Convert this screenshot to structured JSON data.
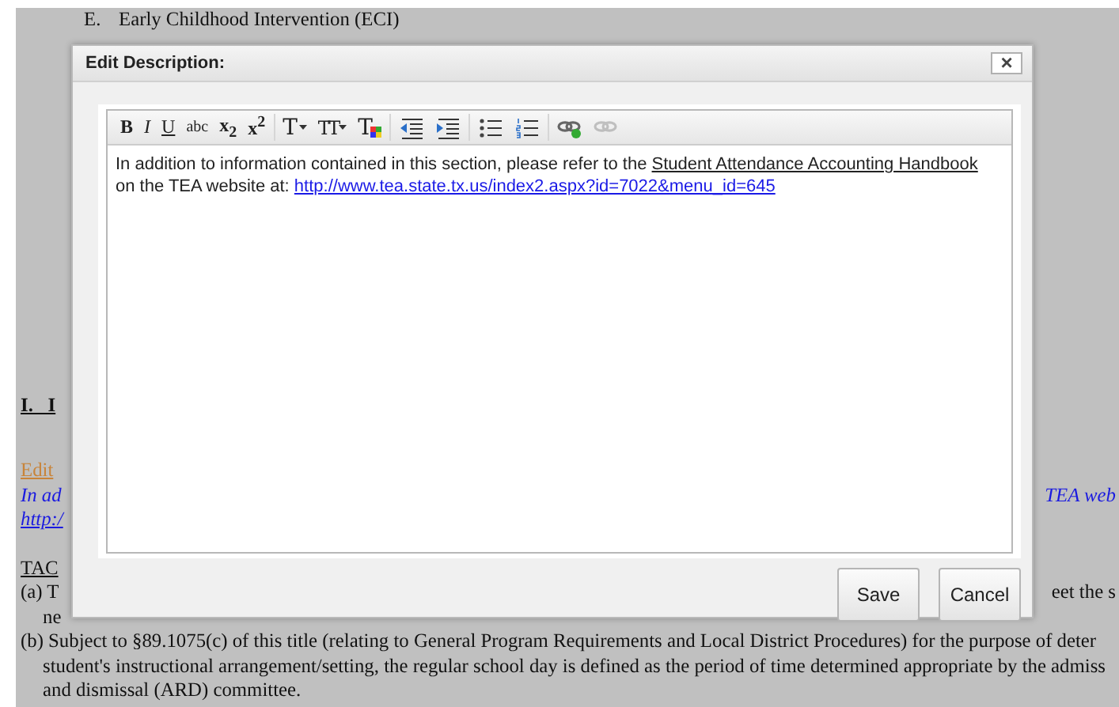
{
  "page": {
    "lines": [
      {
        "kind": "item",
        "left": "E.",
        "text": "Early Childhood Intervention (ECI)"
      },
      {
        "kind": "heading",
        "text": "I.   I"
      },
      {
        "kind": "edit-link",
        "text": "Edit"
      },
      {
        "kind": "note",
        "text": "In ad",
        "right": "TEA web"
      },
      {
        "kind": "note-link",
        "text": "http:/"
      },
      {
        "kind": "section",
        "text": "TAC"
      },
      {
        "kind": "para",
        "text": "(a) T",
        "right": "eet the s"
      },
      {
        "kind": "cont",
        "text": "ne"
      },
      {
        "kind": "para",
        "text": "(b) Subject to §89.1075(c) of this title (relating to General Program Requirements and Local District Procedures) for the purpose of deter"
      },
      {
        "kind": "cont",
        "text": "student's instructional arrangement/setting, the regular school day is defined as the period of time determined appropriate by the admiss"
      },
      {
        "kind": "cont",
        "text": "and dismissal (ARD) committee."
      }
    ]
  },
  "dialog": {
    "title": "Edit Description:",
    "close": "×",
    "toolbar": [
      {
        "kind": "bold",
        "label": "B",
        "disabled": false
      },
      {
        "kind": "italic",
        "label": "I",
        "disabled": false
      },
      {
        "kind": "underline",
        "label": "U",
        "disabled": false
      },
      {
        "kind": "strike",
        "label": "abc",
        "disabled": false
      },
      {
        "kind": "sub",
        "label": "x$_{2}$",
        "disabled": false
      },
      {
        "kind": "sup",
        "label": "x$^{2}$",
        "disabled": false
      },
      {
        "kind": "font",
        "label": "T",
        "disabled": false
      },
      {
        "kind": "size",
        "label": "TT",
        "disabled": false
      },
      {
        "kind": "color",
        "label": "T",
        "disabled": false
      },
      {
        "kind": "outdent",
        "disabled": false
      },
      {
        "kind": "indent",
        "disabled": false
      },
      {
        "kind": "bullets",
        "disabled": false
      },
      {
        "kind": "numbers",
        "disabled": false
      },
      {
        "kind": "link",
        "disabled": false
      },
      {
        "kind": "unlink",
        "disabled": true
      }
    ],
    "content": {
      "text1": "In addition to information contained in this section, please refer to the",
      "link1": "Student Attendance Accounting Handbook",
      "text2": "on the TEA website at:",
      "link2": "http://www.tea.state.tx.us/index2.aspx?id=7022&menu_id=645"
    },
    "buttons": [
      "Save",
      "Cancel"
    ]
  }
}
